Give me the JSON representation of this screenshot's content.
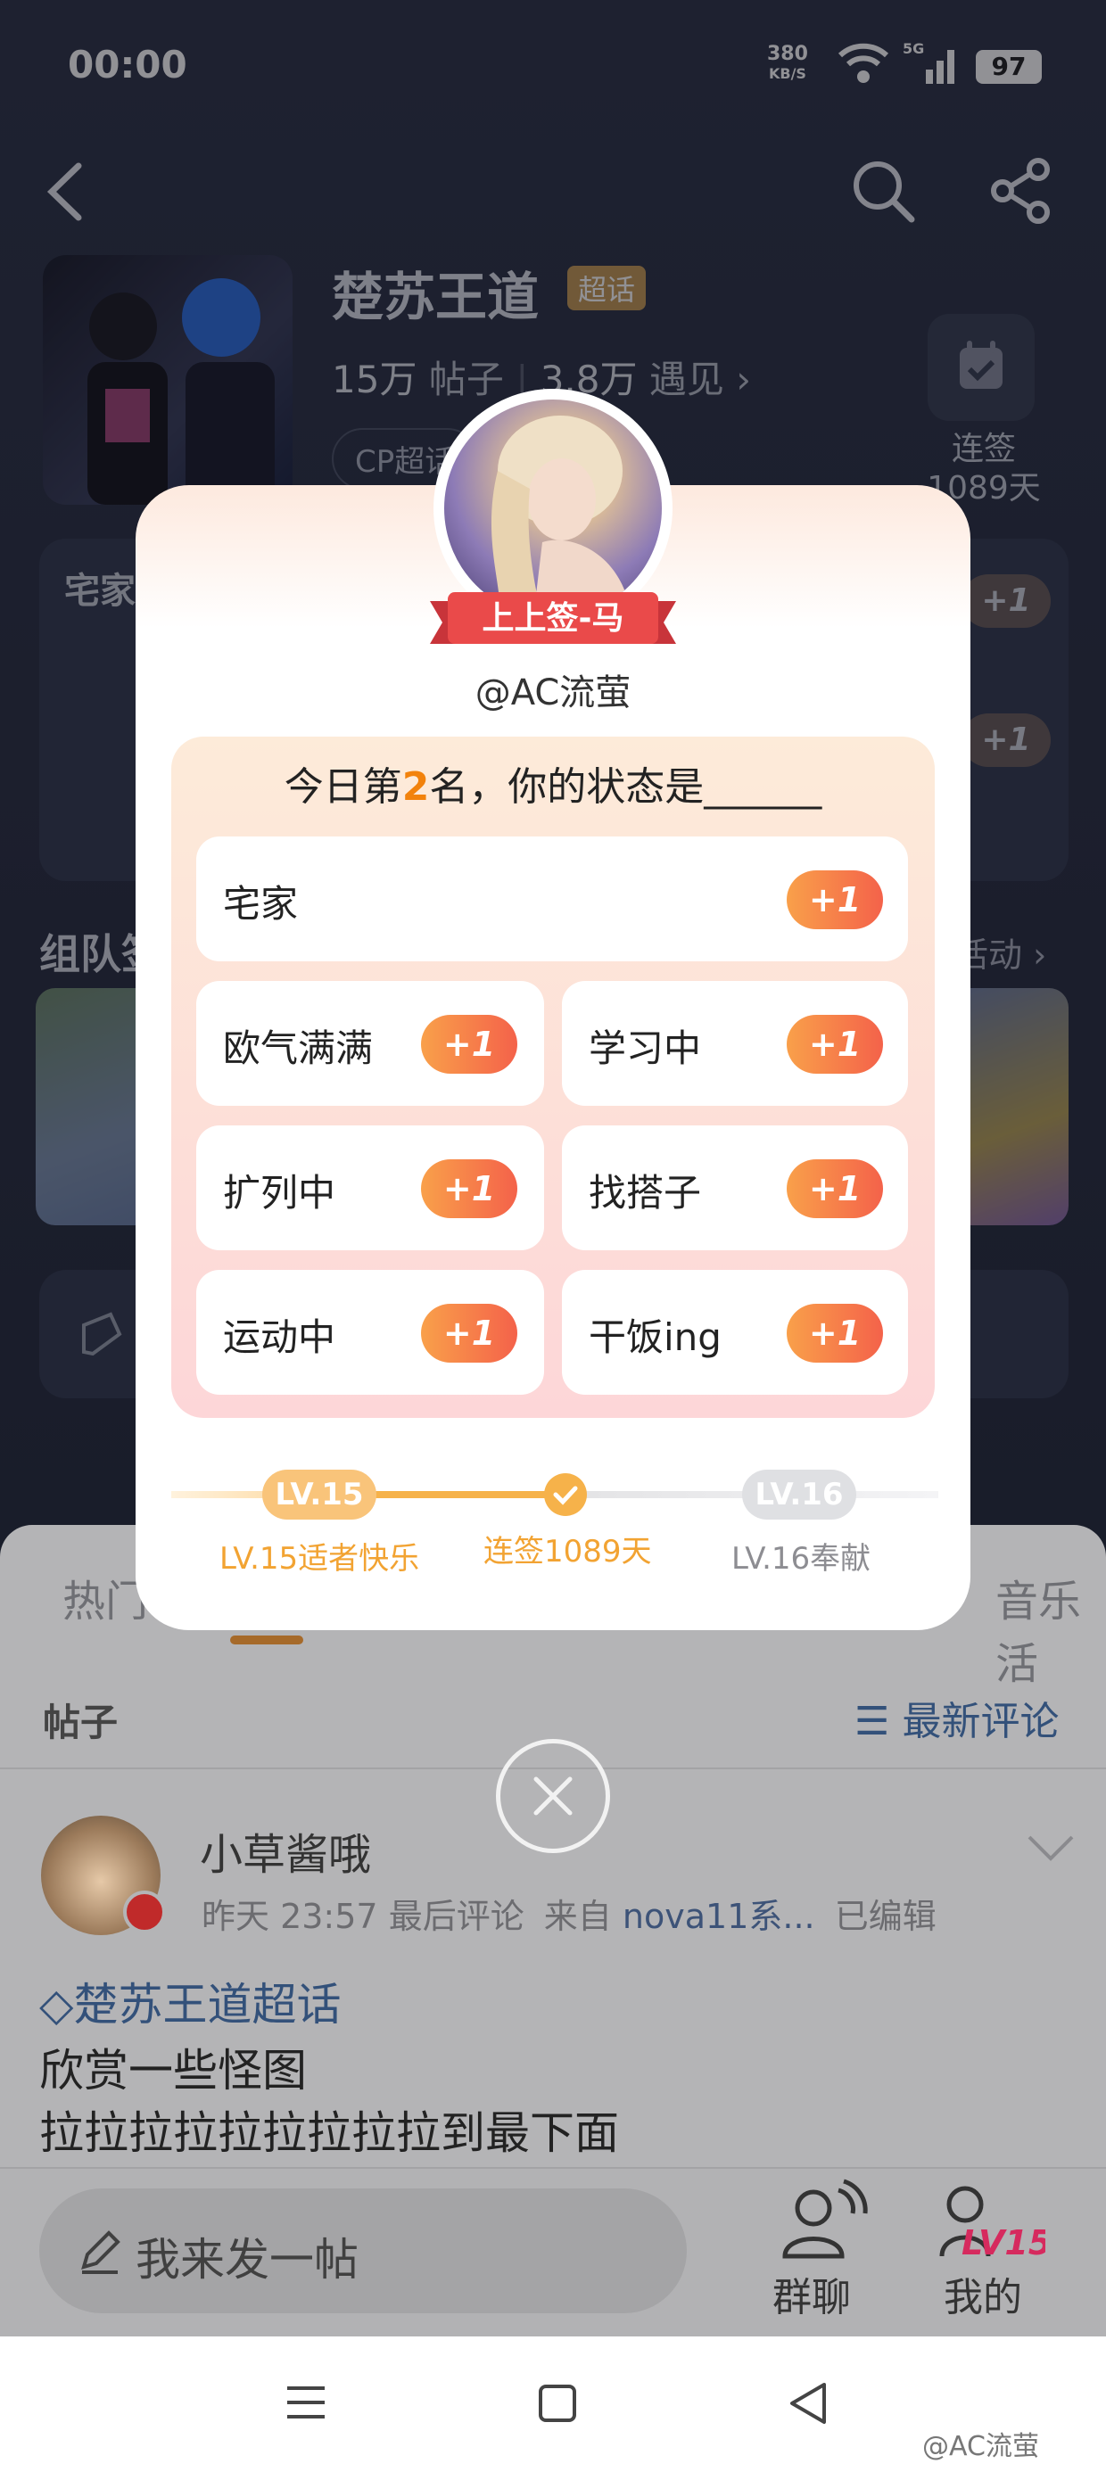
{
  "status": {
    "time": "00:00",
    "net_speed": "380",
    "net_unit": "KB/S",
    "signal_tag": "5G",
    "battery": "97"
  },
  "topic": {
    "title": "楚苏王道",
    "badge": "超话",
    "posts_count": "15万",
    "posts_label": "帖子",
    "meet_count": "3.8万",
    "meet_label": "遇见",
    "cp_tag": "CP超话",
    "checkin_label": "连签",
    "checkin_days": "1089天"
  },
  "bg": {
    "card_title": "宅家",
    "card_plus": "+1",
    "team_title": "组队签",
    "team_more": "活动 ›"
  },
  "popup": {
    "ribbon": "上上签-马",
    "handle": "@AC流萤",
    "question_prefix": "今日第",
    "rank": "2",
    "question_suffix": "名，你的状态是______",
    "options": [
      {
        "label": "宅家",
        "plus": "+1"
      },
      {
        "label": "欧气满满",
        "plus": "+1"
      },
      {
        "label": "学习中",
        "plus": "+1"
      },
      {
        "label": "扩列中",
        "plus": "+1"
      },
      {
        "label": "找搭子",
        "plus": "+1"
      },
      {
        "label": "运动中",
        "plus": "+1"
      },
      {
        "label": "干饭ing",
        "plus": "+1"
      }
    ],
    "level_left": "LV.15",
    "level_right": "LV.16",
    "caption_left": "LV.15适者快乐",
    "caption_mid": "连签1089天",
    "caption_right": "LV.16奉献"
  },
  "tabs": {
    "hot": "热门",
    "music": "音乐活"
  },
  "feed": {
    "posts_label": "帖子",
    "sort_label": "最新评论",
    "post": {
      "user": "小草酱哦",
      "time": "昨天 23:57",
      "time_suffix": "最后评论",
      "from_prefix": "来自",
      "source": "nova11系...",
      "edited": "已编辑",
      "hashtag": "楚苏王道超话",
      "line1": "欣赏一些怪图",
      "line2": "拉拉拉拉拉拉拉拉拉到最下面"
    }
  },
  "bottom": {
    "compose_placeholder": "我来发一帖",
    "group_chat": "群聊",
    "mine": "我的",
    "mine_level": "LV15"
  },
  "watermark": "@AC流萤",
  "colors": {
    "accent_orange": "#f2820c",
    "plus_gradient_start": "#f9a04a",
    "plus_gradient_end": "#f4624a",
    "link_blue": "#33517a",
    "ribbon_red": "#ea4a4a"
  }
}
